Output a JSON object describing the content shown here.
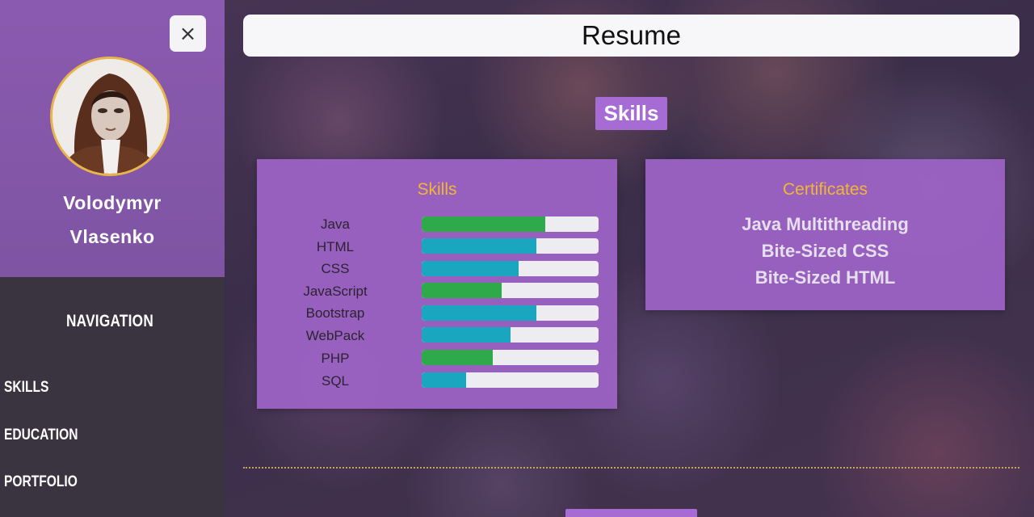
{
  "sidebar": {
    "close_icon": "×",
    "profile": {
      "first_name": "Volodymyr",
      "last_name": "Vlasenko"
    },
    "navigation": {
      "title": "NAVIGATION",
      "items": [
        "SKILLS",
        "EDUCATION",
        "PORTFOLIO"
      ]
    }
  },
  "header": {
    "title": "Resume"
  },
  "section": {
    "badge": "Skills"
  },
  "skills_card": {
    "title": "Skills",
    "skills": [
      {
        "name": "Java",
        "level": 0.7,
        "color": "#2eaa4a"
      },
      {
        "name": "HTML",
        "level": 0.65,
        "color": "#19a6be"
      },
      {
        "name": "CSS",
        "level": 0.55,
        "color": "#19a6be"
      },
      {
        "name": "JavaScript",
        "level": 0.45,
        "color": "#2eaa4a"
      },
      {
        "name": "Bootstrap",
        "level": 0.65,
        "color": "#19a6be"
      },
      {
        "name": "WebPack",
        "level": 0.5,
        "color": "#19a6be"
      },
      {
        "name": "PHP",
        "level": 0.4,
        "color": "#2eaa4a"
      },
      {
        "name": "SQL",
        "level": 0.25,
        "color": "#19a6be"
      }
    ]
  },
  "certificates_card": {
    "title": "Certificates",
    "items": [
      "Java Multithreading",
      "Bite-Sized CSS",
      "Bite-Sized HTML"
    ]
  },
  "colors": {
    "accent_purple": "#a66cd4",
    "card_purple": "#9c62c4",
    "title_gold": "#f2b632",
    "bar_green": "#2eaa4a",
    "bar_teal": "#19a6be"
  }
}
